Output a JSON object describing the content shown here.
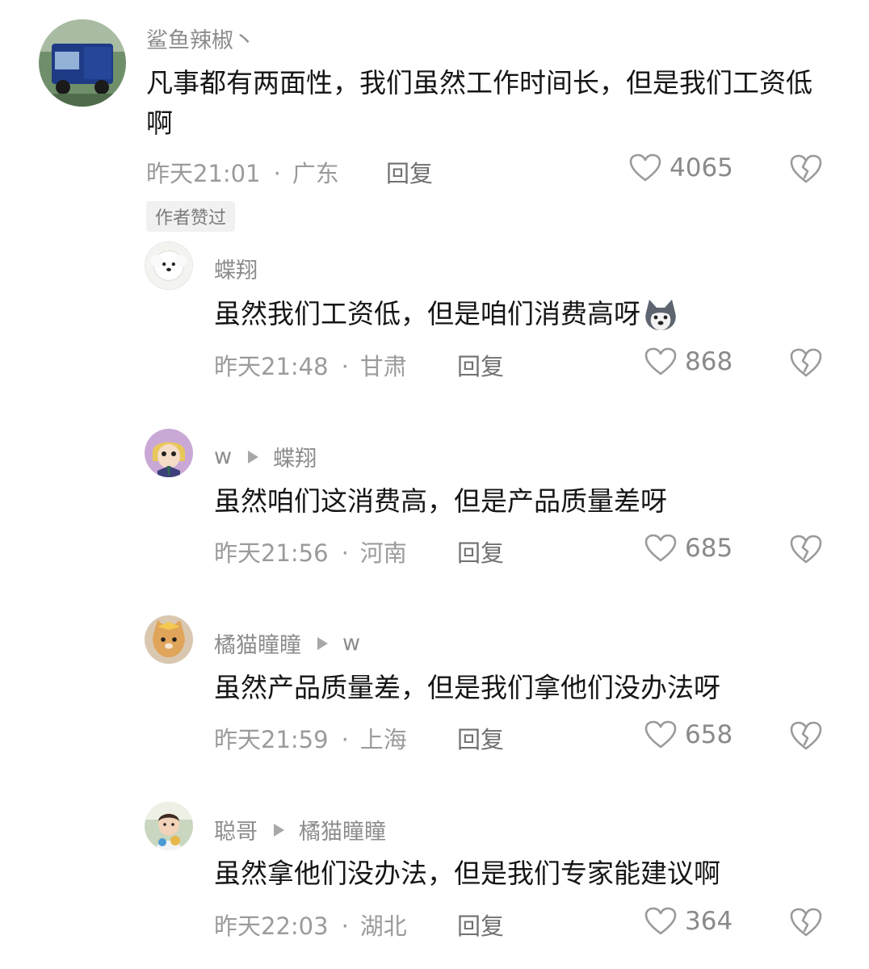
{
  "comments": [
    {
      "username": "鲨鱼辣椒丶",
      "content": "凡事都有两面性，我们虽然工作时间长，但是我们工资低啊",
      "time": "昨天21:01",
      "location": "广东",
      "reply_label": "回复",
      "likes": "4065",
      "badge": "作者赞过",
      "avatar": "blue-truck-avatar"
    }
  ],
  "replies": [
    {
      "username": "蝶翔",
      "reply_to": "",
      "content": "虽然我们工资低，但是咱们消费高呀",
      "emoji": "husky-emoji",
      "time": "昨天21:48",
      "location": "甘肃",
      "reply_label": "回复",
      "likes": "868",
      "avatar": "white-dog-avatar"
    },
    {
      "username": "w",
      "reply_to": "蝶翔",
      "content": "虽然咱们这消费高，但是产品质量差呀",
      "time": "昨天21:56",
      "location": "河南",
      "reply_label": "回复",
      "likes": "685",
      "avatar": "cartoon-character-avatar"
    },
    {
      "username": "橘猫瞳瞳",
      "reply_to": "w",
      "content": "虽然产品质量差，但是我们拿他们没办法呀",
      "time": "昨天21:59",
      "location": "上海",
      "reply_label": "回复",
      "likes": "658",
      "avatar": "orange-cat-avatar"
    },
    {
      "username": "聪哥",
      "reply_to": "橘猫瞳瞳",
      "content": "虽然拿他们没办法，但是我们专家能建议啊",
      "time": "昨天22:03",
      "location": "湖北",
      "reply_label": "回复",
      "likes": "364",
      "avatar": "baby-avatar"
    }
  ],
  "separator": "·",
  "icons": {
    "like": "heart-outline-icon",
    "dislike": "broken-heart-icon",
    "reply_arrow": "reply-arrow-icon"
  },
  "colors": {
    "meta_text": "#9b9b9b",
    "content_text": "#161616",
    "badge_bg": "#f1f1f1"
  }
}
